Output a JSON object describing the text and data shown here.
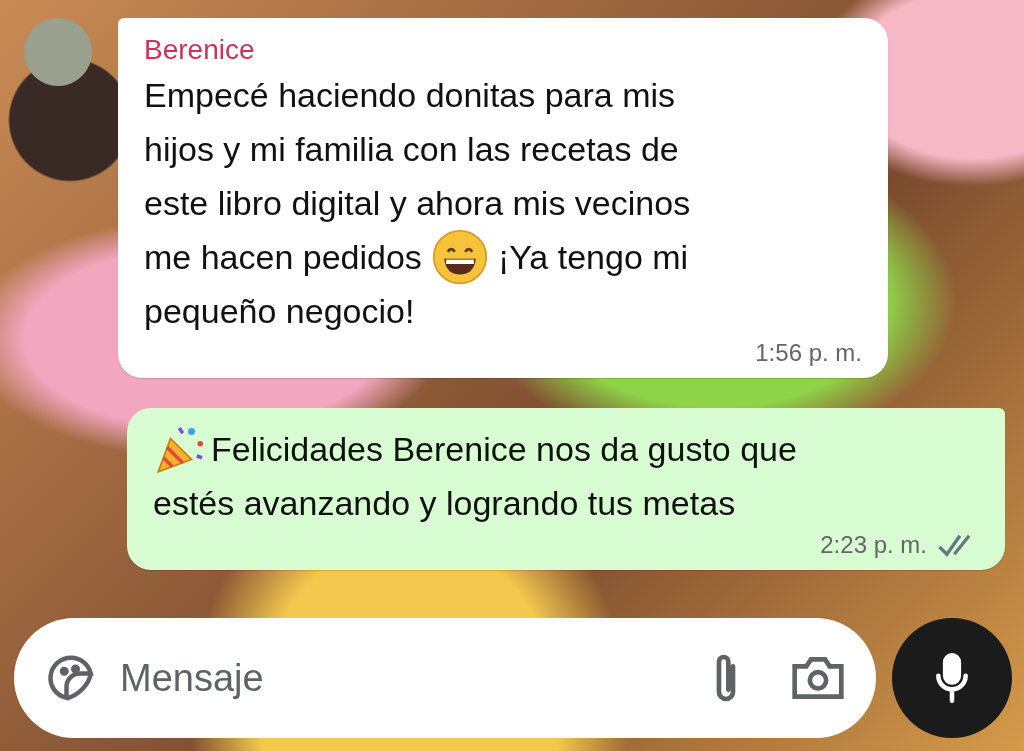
{
  "messages": [
    {
      "kind": "incoming",
      "sender": "Berenice",
      "lines": [
        [
          {
            "kind": "text",
            "text": "Empecé haciendo donitas para mis"
          }
        ],
        [
          {
            "kind": "text",
            "text": "hijos y mi familia con las recetas de"
          }
        ],
        [
          {
            "kind": "text",
            "text": "este libro digital y ahora mis vecinos"
          }
        ],
        [
          {
            "kind": "text",
            "text": "me hacen pedidos"
          },
          {
            "kind": "grin"
          },
          {
            "kind": "text",
            "text": "¡Ya tengo mi"
          }
        ],
        [
          {
            "kind": "text",
            "text": "pequeño negocio!"
          }
        ]
      ],
      "time": "1:56 p. m."
    },
    {
      "kind": "outgoing",
      "lines": [
        [
          {
            "kind": "party"
          },
          {
            "kind": "text",
            "text": "Felicidades Berenice nos da gusto que"
          }
        ],
        [
          {
            "kind": "text",
            "text": "estés avanzando y logrando tus metas"
          }
        ]
      ],
      "time": "2:23 p. m.",
      "read": false
    }
  ],
  "composer": {
    "placeholder": "Mensaje"
  }
}
